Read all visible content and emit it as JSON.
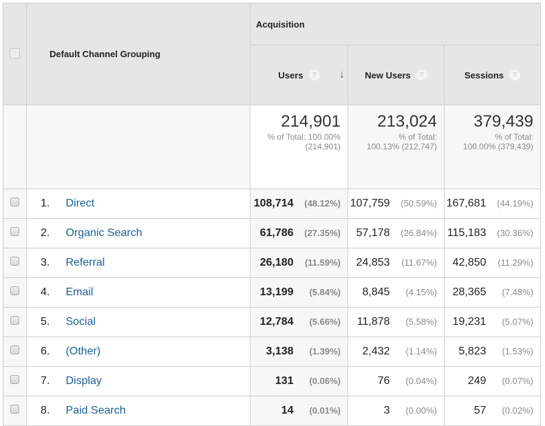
{
  "header": {
    "dimension_label": "Default Channel Grouping",
    "group_label": "Acquisition",
    "metrics": [
      {
        "label": "Users",
        "help": "?",
        "sorted": true,
        "sort_icon": "arrow-down"
      },
      {
        "label": "New Users",
        "help": "?",
        "sorted": false
      },
      {
        "label": "Sessions",
        "help": "?",
        "sorted": false
      }
    ]
  },
  "totals": {
    "users": {
      "value": "214,901",
      "sub": "% of Total: 100.00% (214,901)"
    },
    "new_users": {
      "value": "213,024",
      "sub_line1": "% of Total:",
      "sub_line2": "100.13% (212,747)"
    },
    "sessions": {
      "value": "379,439",
      "sub_line1": "% of Total:",
      "sub_line2": "100.00% (379,439)"
    }
  },
  "rows": [
    {
      "num": "1.",
      "channel": "Direct",
      "users": "108,714",
      "users_pct": "(48.12%)",
      "new_users": "107,759",
      "new_users_pct": "(50.59%)",
      "sessions": "167,681",
      "sessions_pct": "(44.19%)"
    },
    {
      "num": "2.",
      "channel": "Organic Search",
      "users": "61,786",
      "users_pct": "(27.35%)",
      "new_users": "57,178",
      "new_users_pct": "(26.84%)",
      "sessions": "115,183",
      "sessions_pct": "(30.36%)"
    },
    {
      "num": "3.",
      "channel": "Referral",
      "users": "26,180",
      "users_pct": "(11.59%)",
      "new_users": "24,853",
      "new_users_pct": "(11.67%)",
      "sessions": "42,850",
      "sessions_pct": "(11.29%)"
    },
    {
      "num": "4.",
      "channel": "Email",
      "users": "13,199",
      "users_pct": "(5.84%)",
      "new_users": "8,845",
      "new_users_pct": "(4.15%)",
      "sessions": "28,365",
      "sessions_pct": "(7.48%)"
    },
    {
      "num": "5.",
      "channel": "Social",
      "users": "12,784",
      "users_pct": "(5.66%)",
      "new_users": "11,878",
      "new_users_pct": "(5.58%)",
      "sessions": "19,231",
      "sessions_pct": "(5.07%)"
    },
    {
      "num": "6.",
      "channel": "(Other)",
      "users": "3,138",
      "users_pct": "(1.39%)",
      "new_users": "2,432",
      "new_users_pct": "(1.14%)",
      "sessions": "5,823",
      "sessions_pct": "(1.53%)"
    },
    {
      "num": "7.",
      "channel": "Display",
      "users": "131",
      "users_pct": "(0.06%)",
      "new_users": "76",
      "new_users_pct": "(0.04%)",
      "sessions": "249",
      "sessions_pct": "(0.07%)"
    },
    {
      "num": "8.",
      "channel": "Paid Search",
      "users": "14",
      "users_pct": "(0.01%)",
      "new_users": "3",
      "new_users_pct": "(0.00%)",
      "sessions": "57",
      "sessions_pct": "(0.02%)"
    }
  ],
  "colors": {
    "link": "#1a5e96",
    "header_bg": "#e6e6e6",
    "muted_text": "#8a8a8a"
  }
}
